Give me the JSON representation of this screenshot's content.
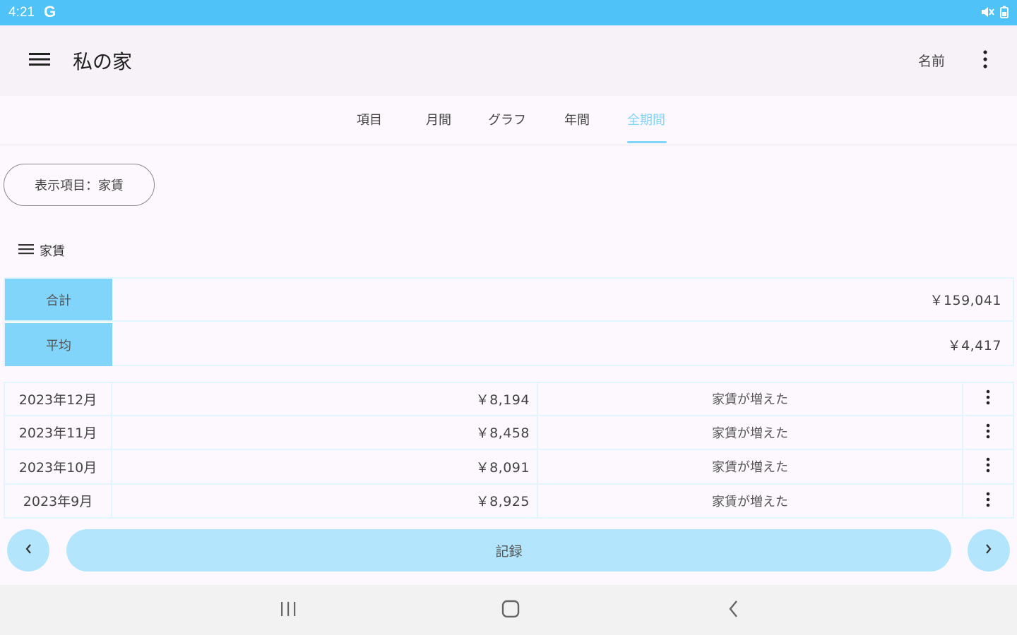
{
  "status_bar": {
    "time": "4:21",
    "g_label": "G"
  },
  "app_bar": {
    "title": "私の家",
    "name_label": "名前"
  },
  "tabs": [
    {
      "label": "項目",
      "active": false
    },
    {
      "label": "月間",
      "active": false
    },
    {
      "label": "グラフ",
      "active": false
    },
    {
      "label": "年間",
      "active": false
    },
    {
      "label": "全期間",
      "active": true
    }
  ],
  "filter": {
    "label": "表示項目：家賃"
  },
  "section": {
    "title": "家賃"
  },
  "summary": {
    "total_label": "合計",
    "total_value": "￥159,041",
    "avg_label": "平均",
    "avg_value": "￥4,417"
  },
  "records": [
    {
      "date": "2023年12月",
      "amount": "￥8,194",
      "memo": "家賃が増えた"
    },
    {
      "date": "2023年11月",
      "amount": "￥8,458",
      "memo": "家賃が増えた"
    },
    {
      "date": "2023年10月",
      "amount": "￥8,091",
      "memo": "家賃が増えた"
    },
    {
      "date": "2023年9月",
      "amount": "￥8,925",
      "memo": "家賃が増えた"
    }
  ],
  "actions": {
    "record_label": "記録"
  },
  "colors": {
    "status_bar": "#4fc3f7",
    "accent": "#81d4fa",
    "button": "#b3e5fc",
    "border": "#e1f5fe"
  },
  "icons": {
    "menu": "hamburger-menu-icon",
    "more": "vertical-dots-icon",
    "prev": "chevron-left-icon",
    "next": "chevron-right-icon"
  }
}
